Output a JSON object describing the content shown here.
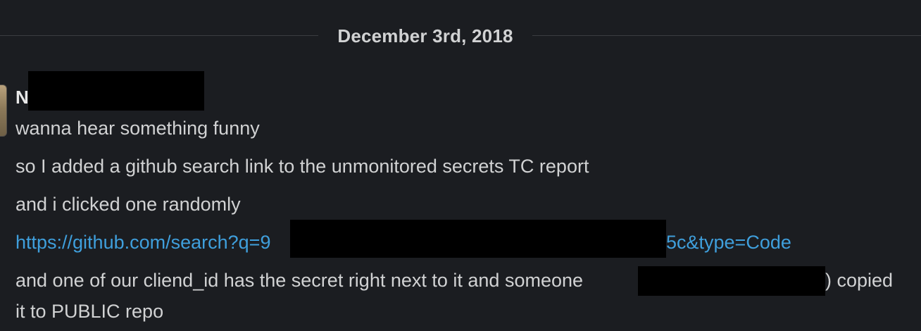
{
  "divider": {
    "date": "December 3rd, 2018"
  },
  "message": {
    "sender_visible": "N",
    "lines": [
      "wanna hear something funny",
      "so I added a github search link to the unmonitored secrets TC report",
      "and i clicked one randomly"
    ],
    "link_start": "https://github.com/search?q=9",
    "link_end": "5c&type=Code",
    "line5_start": "and one of our cliend_id has the secret right next to it and someone",
    "line5_end": ") copied",
    "line6": "it to PUBLIC repo"
  },
  "colors": {
    "background": "#1b1d21",
    "text": "#d1d2d3",
    "link": "#3f9fdc",
    "redaction": "#000000"
  }
}
